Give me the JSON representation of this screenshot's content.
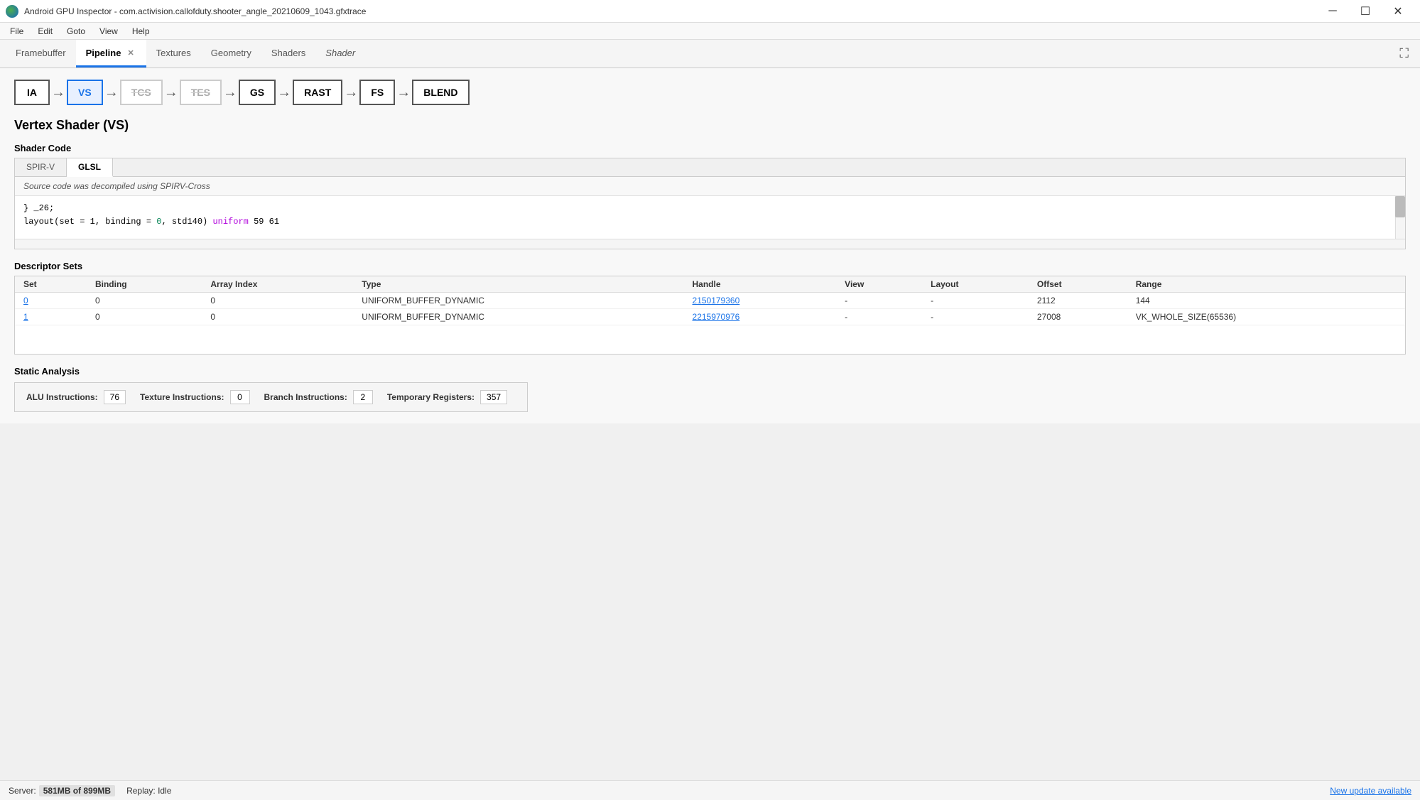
{
  "titleBar": {
    "icon": "android-gpu-inspector-icon",
    "title": "Android GPU Inspector - com.activision.callofduty.shooter_angle_20210609_1043.gfxtrace",
    "minimize": "─",
    "maximize": "☐",
    "close": "✕"
  },
  "menuBar": {
    "items": [
      "File",
      "Edit",
      "Goto",
      "View",
      "Help"
    ]
  },
  "tabs": [
    {
      "id": "framebuffer",
      "label": "Framebuffer",
      "active": false,
      "closable": false,
      "italic": false
    },
    {
      "id": "pipeline",
      "label": "Pipeline",
      "active": true,
      "closable": true,
      "italic": false
    },
    {
      "id": "textures",
      "label": "Textures",
      "active": false,
      "closable": false,
      "italic": false
    },
    {
      "id": "geometry",
      "label": "Geometry",
      "active": false,
      "closable": false,
      "italic": false
    },
    {
      "id": "shaders",
      "label": "Shaders",
      "active": false,
      "closable": false,
      "italic": false
    },
    {
      "id": "shader",
      "label": "Shader",
      "active": false,
      "closable": false,
      "italic": true
    }
  ],
  "expandIcon": "⛶",
  "pipeline": {
    "nodes": [
      {
        "id": "ia",
        "label": "IA",
        "state": "normal"
      },
      {
        "id": "vs",
        "label": "VS",
        "state": "active"
      },
      {
        "id": "tcs",
        "label": "TCS",
        "state": "dimmed"
      },
      {
        "id": "tes",
        "label": "TES",
        "state": "dimmed"
      },
      {
        "id": "gs",
        "label": "GS",
        "state": "normal"
      },
      {
        "id": "rast",
        "label": "RAST",
        "state": "normal"
      },
      {
        "id": "fs",
        "label": "FS",
        "state": "normal"
      },
      {
        "id": "blend",
        "label": "BLEND",
        "state": "normal"
      }
    ]
  },
  "vertexShader": {
    "sectionTitle": "Vertex Shader (VS)",
    "shaderCodeLabel": "Shader Code",
    "codeTabs": [
      {
        "id": "spir-v",
        "label": "SPIR-V",
        "active": false
      },
      {
        "id": "glsl",
        "label": "GLSL",
        "active": true
      }
    ],
    "codeHeader": "Source code was decompiled using SPIRV-Cross",
    "codeLines": [
      {
        "text": "} _26;"
      },
      {
        "text": "layout(set = 1, binding = 0, std140) uniform 59 61",
        "hasColor": true
      }
    ]
  },
  "descriptorSets": {
    "label": "Descriptor Sets",
    "columns": [
      "Set",
      "Binding",
      "Array Index",
      "Type",
      "Handle",
      "View",
      "Layout",
      "Offset",
      "Range"
    ],
    "rows": [
      {
        "set": "0",
        "setIsLink": true,
        "binding": "0",
        "arrayIndex": "0",
        "type": "UNIFORM_BUFFER_DYNAMIC",
        "handle": "2150179360",
        "handleIsLink": true,
        "view": "-",
        "layout": "-",
        "offset": "2112",
        "range": "144"
      },
      {
        "set": "1",
        "setIsLink": true,
        "binding": "0",
        "arrayIndex": "0",
        "type": "UNIFORM_BUFFER_DYNAMIC",
        "handle": "2215970976",
        "handleIsLink": true,
        "view": "-",
        "layout": "-",
        "offset": "27008",
        "range": "VK_WHOLE_SIZE(65536)"
      }
    ]
  },
  "staticAnalysis": {
    "label": "Static Analysis",
    "stats": [
      {
        "label": "ALU Instructions:",
        "value": "76"
      },
      {
        "label": "Texture Instructions:",
        "value": "0"
      },
      {
        "label": "Branch Instructions:",
        "value": "2"
      },
      {
        "label": "Temporary Registers:",
        "value": "357"
      }
    ]
  },
  "statusBar": {
    "serverLabel": "Server:",
    "serverMem": "581MB of 899MB",
    "replayLabel": "Replay: Idle",
    "updateLink": "New update available"
  }
}
